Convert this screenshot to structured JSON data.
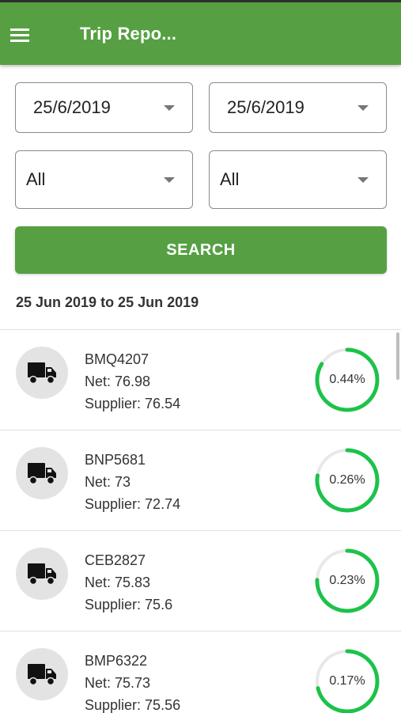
{
  "header": {
    "title": "Trip Repo...",
    "menu_icon": "hamburger-menu-icon"
  },
  "filters": {
    "from_date": "25/6/2019",
    "to_date": "25/6/2019",
    "filter_a": "All",
    "filter_b": "All"
  },
  "search_label": "SEARCH",
  "date_range": "25 Jun 2019 to 25 Jun 2019",
  "colors": {
    "primary": "#56a043",
    "ring": "#1dc24a",
    "ring_track": "#e8e8e8"
  },
  "trips": [
    {
      "vehicle": "BMQ4207",
      "net": "Net: 76.98",
      "supplier": "Supplier: 76.54",
      "percent": "0.44%"
    },
    {
      "vehicle": "BNP5681",
      "net": "Net: 73",
      "supplier": "Supplier: 72.74",
      "percent": "0.26%"
    },
    {
      "vehicle": "CEB2827",
      "net": "Net: 75.83",
      "supplier": "Supplier: 75.6",
      "percent": "0.23%"
    },
    {
      "vehicle": "BMP6322",
      "net": "Net: 75.73",
      "supplier": "Supplier: 75.56",
      "percent": "0.17%"
    }
  ]
}
